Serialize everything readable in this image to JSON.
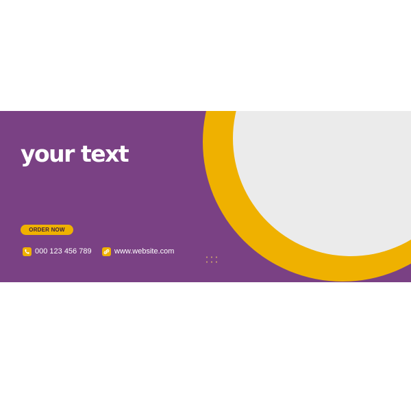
{
  "headline": "your text",
  "cta": {
    "label": "ORDER NOW"
  },
  "contacts": {
    "phone": {
      "icon": "phone-icon",
      "text": "000 123 456 789"
    },
    "website": {
      "icon": "link-icon",
      "text": "www.website.com"
    }
  },
  "colors": {
    "purple": "#7a4184",
    "yellow": "#efb100",
    "light_gray": "#ebebeb",
    "white": "#ffffff",
    "dark_text": "#3a1d40",
    "dots": "#c9a070"
  }
}
